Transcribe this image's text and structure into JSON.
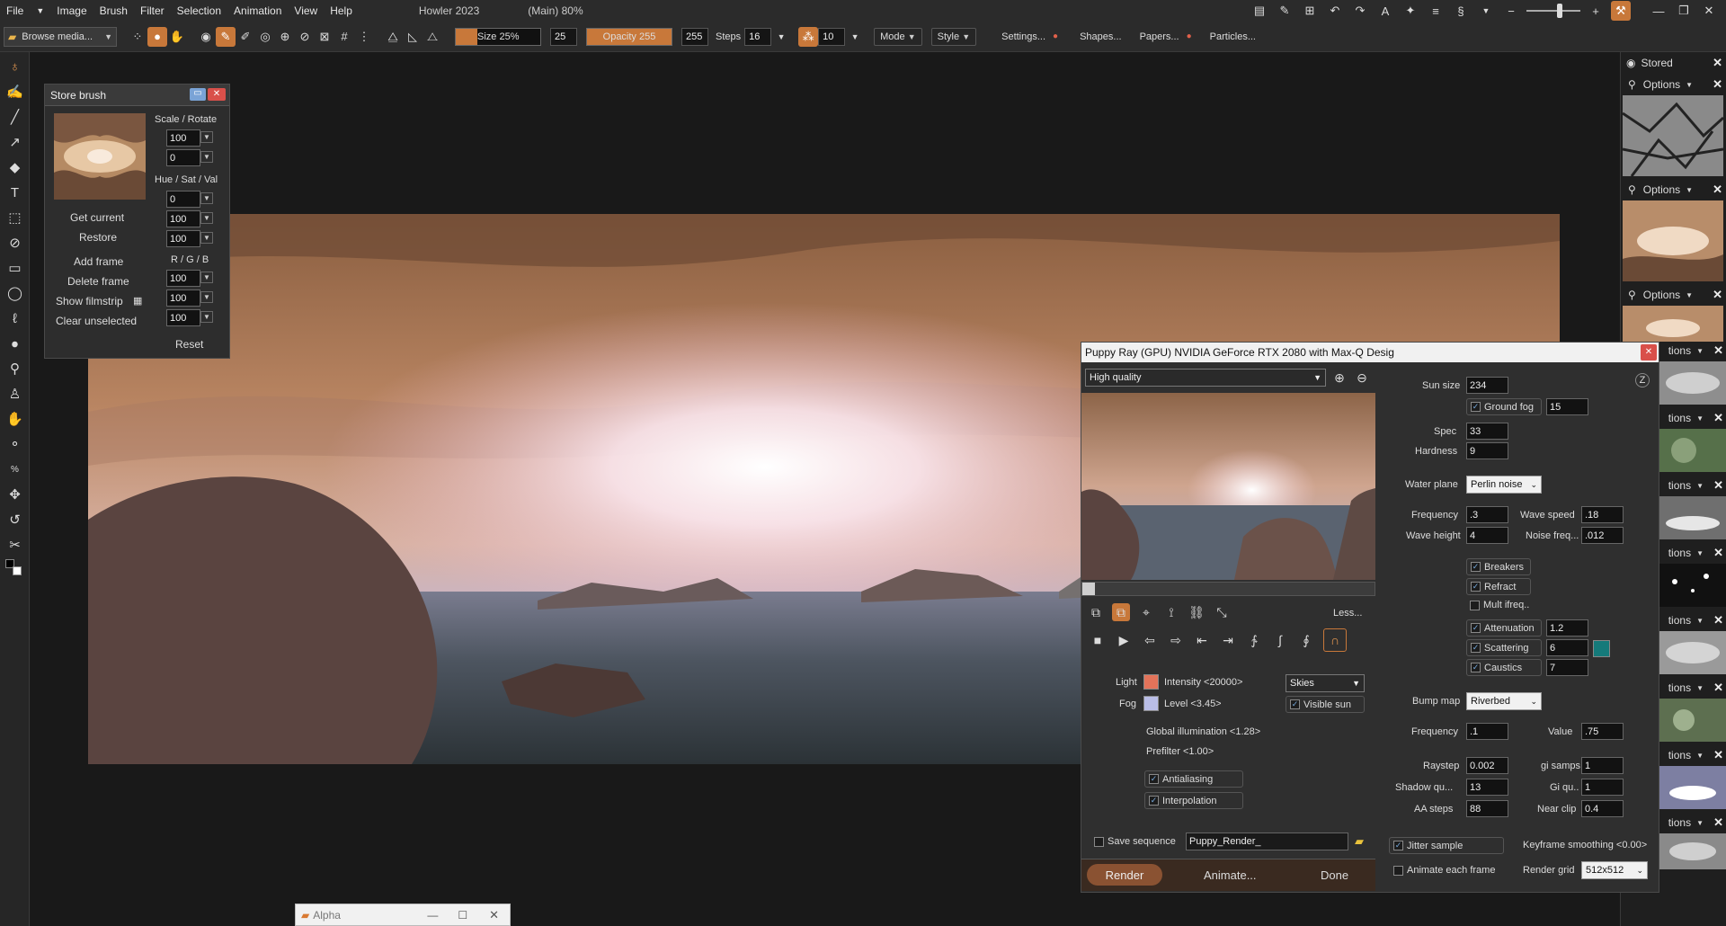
{
  "menu": {
    "file": "File",
    "image": "Image",
    "brush": "Brush",
    "filter": "Filter",
    "selection": "Selection",
    "animation": "Animation",
    "view": "View",
    "help": "Help",
    "app_title": "Howler 2023",
    "doc_title": "(Main)  80%"
  },
  "toolbar": {
    "browse": "Browse media...",
    "size_label": "Size 25%",
    "size_value": "25",
    "opacity_label": "Opacity 255",
    "opacity_value": "255",
    "steps_label": "Steps",
    "steps_value": "16",
    "jitter_value": "10",
    "mode": "Mode",
    "style": "Style",
    "settings": "Settings...",
    "shapes": "Shapes...",
    "papers": "Papers...",
    "particles": "Particles..."
  },
  "store_brush": {
    "title": "Store brush",
    "scale_rotate": "Scale / Rotate",
    "scale": "100",
    "rotate": "0",
    "hsv_label": "Hue / Sat / Val",
    "hue": "0",
    "sat": "100",
    "val": "100",
    "rgb_label": "R / G / B",
    "r": "100",
    "g": "100",
    "b": "100",
    "get_current": "Get current",
    "restore": "Restore",
    "add_frame": "Add frame",
    "delete_frame": "Delete frame",
    "show_filmstrip": "Show filmstrip",
    "clear_unselected": "Clear unselected",
    "reset": "Reset"
  },
  "right_panel": {
    "stored": "Stored",
    "options": "Options",
    "options_short": "tions"
  },
  "puppy": {
    "title": "Puppy Ray (GPU)  NVIDIA GeForce RTX 2080 with Max-Q Desig",
    "quality": "High quality",
    "less": "Less...",
    "light": "Light",
    "intensity": "Intensity <20000>",
    "fog": "Fog",
    "level": "Level <3.45>",
    "skies": "Skies",
    "visible_sun": "Visible sun",
    "gi": "Global illumination <1.28>",
    "prefilter": "Prefilter <1.00>",
    "antialiasing": "Antialiasing",
    "interpolation": "Interpolation",
    "save_sequence": "Save sequence",
    "seq_name": "Puppy_Render_",
    "render": "Render",
    "animate": "Animate...",
    "done": "Done",
    "sun_size_l": "Sun size",
    "sun_size": "234",
    "ground_fog": "Ground fog",
    "ground_fog_v": "15",
    "spec_l": "Spec",
    "spec": "33",
    "hardness_l": "Hardness",
    "hardness": "9",
    "water_plane_l": "Water plane",
    "water_plane": "Perlin noise",
    "frequency_l": "Frequency",
    "frequency": ".3",
    "wave_speed_l": "Wave speed",
    "wave_speed": ".18",
    "wave_height_l": "Wave height",
    "wave_height": "4",
    "noise_freq_l": "Noise freq...",
    "noise_freq": ".012",
    "breakers": "Breakers",
    "refract": "Refract",
    "mult_freq": "Mult ifreq..",
    "attenuation": "Attenuation",
    "attenuation_v": "1.2",
    "scattering": "Scattering",
    "scattering_v": "6",
    "caustics": "Caustics",
    "caustics_v": "7",
    "bump_map_l": "Bump map",
    "bump_map": "Riverbed",
    "bump_freq_l": "Frequency",
    "bump_freq": ".1",
    "value_l": "Value",
    "value": ".75",
    "raystep_l": "Raystep",
    "raystep": "0.002",
    "gi_samps_l": "gi samps",
    "gi_samps": "1",
    "shadow_l": "Shadow qu...",
    "shadow": "13",
    "gi_qu_l": "Gi qu..",
    "gi_qu": "1",
    "aa_steps_l": "AA steps",
    "aa_steps": "88",
    "near_clip_l": "Near clip",
    "near_clip": "0.4",
    "jitter": "Jitter sample",
    "keyframe": "Keyframe smoothing <0.00>",
    "animate_each": "Animate each frame",
    "render_grid_l": "Render grid",
    "render_grid": "512x512"
  },
  "alpha": {
    "title": "Alpha"
  },
  "colors": {
    "accent": "#c8783a",
    "light_swatch": "#e2735a",
    "fog_swatch": "#b9bde6",
    "scatter_swatch": "#157a7a"
  }
}
